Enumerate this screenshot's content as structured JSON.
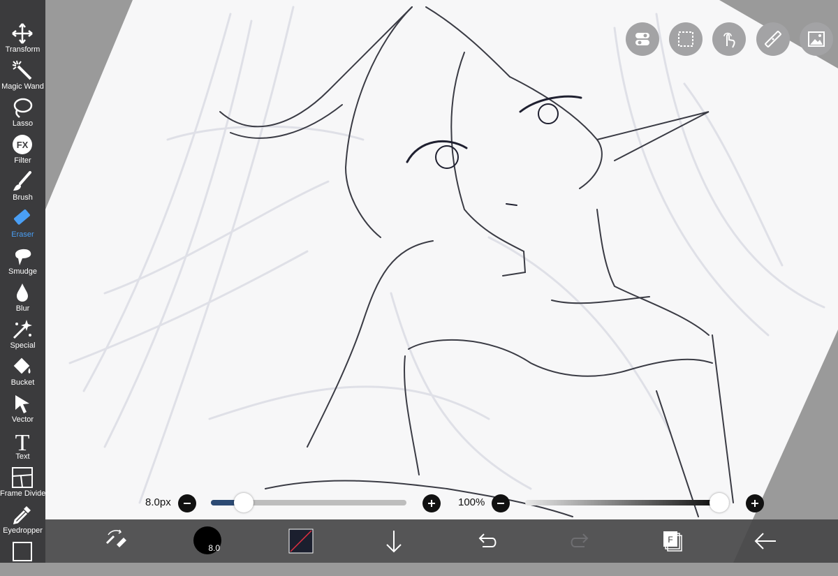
{
  "toolbar": {
    "items": [
      {
        "label": "Transform",
        "icon": "transform-icon"
      },
      {
        "label": "Magic Wand",
        "icon": "magic-wand-icon"
      },
      {
        "label": "Lasso",
        "icon": "lasso-icon"
      },
      {
        "label": "Filter",
        "icon": "filter-icon"
      },
      {
        "label": "Brush",
        "icon": "brush-icon"
      },
      {
        "label": "Eraser",
        "icon": "eraser-icon",
        "active": true
      },
      {
        "label": "Smudge",
        "icon": "smudge-icon"
      },
      {
        "label": "Blur",
        "icon": "blur-icon"
      },
      {
        "label": "Special",
        "icon": "special-icon"
      },
      {
        "label": "Bucket",
        "icon": "bucket-icon"
      },
      {
        "label": "Vector",
        "icon": "vector-icon"
      },
      {
        "label": "Text",
        "icon": "text-icon"
      },
      {
        "label": "Frame Divider",
        "icon": "frame-divider-icon"
      },
      {
        "label": "Eyedropper",
        "icon": "eyedropper-icon"
      },
      {
        "label": "",
        "icon": "canvas-icon"
      }
    ],
    "filter_glyph": "FX",
    "text_glyph": "T"
  },
  "top_buttons": [
    "toggle-icon",
    "selection-icon",
    "touch-icon",
    "ruler-icon",
    "image-icon"
  ],
  "brush_size": {
    "label": "8.0px",
    "value_fraction": 0.13
  },
  "opacity": {
    "label": "100%",
    "value_fraction": 1.0
  },
  "bottom_bar": {
    "brush_indicator": "8.0",
    "layers_glyph": "F"
  },
  "colors": {
    "toolbar_bg": "#3b3b3d",
    "accent": "#4a9ff5",
    "slider_fill": "#2c4a73",
    "canvas": "#f7f7f8"
  }
}
